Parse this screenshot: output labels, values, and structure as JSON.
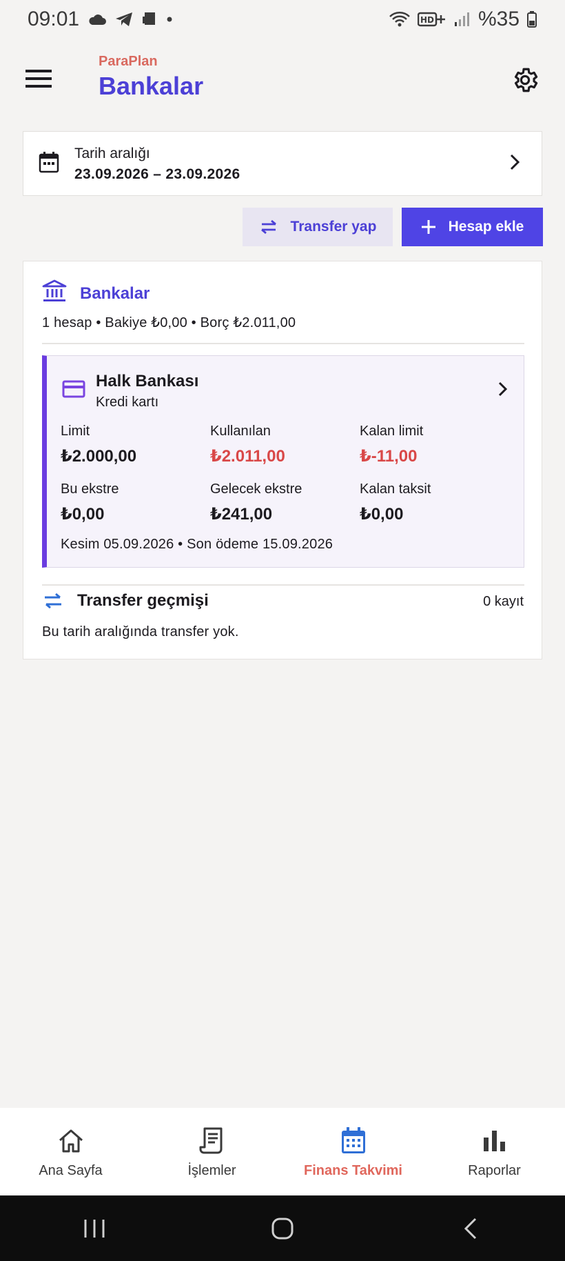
{
  "status_bar": {
    "time": "09:01",
    "battery": "%35"
  },
  "header": {
    "app_name": "ParaPlan",
    "title": "Bankalar"
  },
  "date_range": {
    "label": "Tarih aralığı",
    "value": "23.09.2026 – 23.09.2026"
  },
  "actions": {
    "transfer": "Transfer yap",
    "add_account": "Hesap ekle"
  },
  "banks": {
    "title": "Bankalar",
    "summary": "1 hesap • Bakiye ₺0,00 • Borç ₺2.011,00",
    "accounts": [
      {
        "name": "Halk Bankası",
        "type": "Kredi kartı",
        "metrics": [
          {
            "label": "Limit",
            "value": "₺2.000,00"
          },
          {
            "label": "Kullanılan",
            "value": "₺2.011,00"
          },
          {
            "label": "Kalan limit",
            "value": "₺-11,00"
          },
          {
            "label": "Bu ekstre",
            "value": "₺0,00"
          },
          {
            "label": "Gelecek ekstre",
            "value": "₺241,00"
          },
          {
            "label": "Kalan taksit",
            "value": "₺0,00"
          }
        ],
        "dates": "Kesim 05.09.2026 • Son ödeme 15.09.2026"
      }
    ]
  },
  "transfer_history": {
    "title": "Transfer geçmişi",
    "count": "0 kayıt",
    "empty_text": "Bu tarih aralığında transfer yok."
  },
  "bottom_nav": [
    {
      "label": "Ana Sayfa",
      "icon": "home-icon"
    },
    {
      "label": "İşlemler",
      "icon": "receipt-icon"
    },
    {
      "label": "Finans Takvimi",
      "icon": "calendar-icon",
      "active": true
    },
    {
      "label": "Raporlar",
      "icon": "bar-chart-icon"
    }
  ],
  "colors": {
    "brand": "#4c40d6",
    "accent": "#e0675c",
    "negative": "#d94848",
    "card_accent": "#6a3ce0"
  }
}
